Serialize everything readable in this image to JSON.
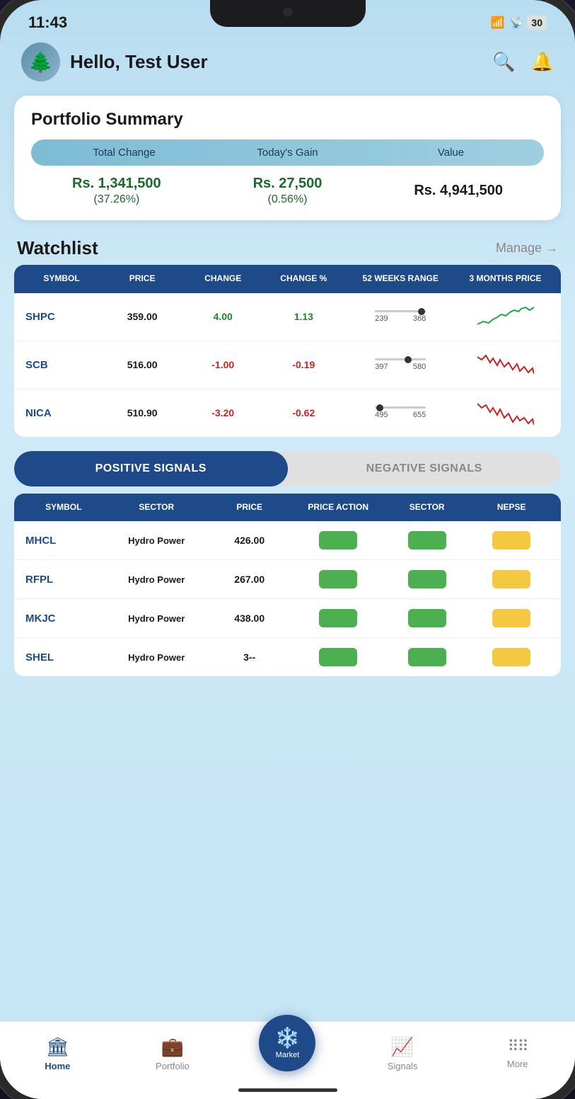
{
  "status": {
    "time": "11:43",
    "battery": "30"
  },
  "header": {
    "greeting": "Hello, Test User"
  },
  "portfolio": {
    "title": "Portfolio Summary",
    "col_total_change": "Total Change",
    "col_todays_gain": "Today's Gain",
    "col_value": "Value",
    "total_change_amount": "Rs. 1,341,500",
    "total_change_percent": "(37.26%)",
    "todays_gain_amount": "Rs. 27,500",
    "todays_gain_percent": "(0.56%)",
    "value_amount": "Rs. 4,941,500"
  },
  "watchlist": {
    "title": "Watchlist",
    "manage_label": "Manage →",
    "headers": [
      "SYMBOL",
      "PRICE",
      "CHANGE",
      "CHANGE %",
      "52 WEEKS RANGE",
      "3 MONTHS PRICE"
    ],
    "rows": [
      {
        "symbol": "SHPC",
        "price": "359.00",
        "change": "4.00",
        "change_pct": "1.13",
        "range_min": "239",
        "range_max": "368",
        "dot_pct": 92,
        "trend": "up"
      },
      {
        "symbol": "SCB",
        "price": "516.00",
        "change": "-1.00",
        "change_pct": "-0.19",
        "range_min": "397",
        "range_max": "580",
        "dot_pct": 65,
        "trend": "down"
      },
      {
        "symbol": "NICA",
        "price": "510.90",
        "change": "-3.20",
        "change_pct": "-0.62",
        "range_min": "495",
        "range_max": "655",
        "dot_pct": 10,
        "trend": "down"
      }
    ]
  },
  "signals": {
    "positive_label": "POSITIVE SIGNALS",
    "negative_label": "NEGATIVE SIGNALS",
    "active_tab": "positive",
    "headers": [
      "SYMBOL",
      "SECTOR",
      "PRICE",
      "PRICE ACTION",
      "SECTOR",
      "NEPSE"
    ],
    "rows": [
      {
        "symbol": "MHCL",
        "sector": "Hydro Power",
        "price": "426.00",
        "price_action": "green",
        "sector_badge": "green",
        "nepse_badge": "yellow"
      },
      {
        "symbol": "RFPL",
        "sector": "Hydro Power",
        "price": "267.00",
        "price_action": "green",
        "sector_badge": "green",
        "nepse_badge": "yellow"
      },
      {
        "symbol": "MKJC",
        "sector": "Hydro Power",
        "price": "438.00",
        "price_action": "green",
        "sector_badge": "green",
        "nepse_badge": "yellow"
      },
      {
        "symbol": "SHEL",
        "sector": "Hydro Power",
        "price": "3??",
        "price_action": "green",
        "sector_badge": "green",
        "nepse_badge": "yellow"
      }
    ]
  },
  "bottom_nav": {
    "items": [
      {
        "label": "Home",
        "icon": "🏛",
        "active": true
      },
      {
        "label": "Portfolio",
        "icon": "💼",
        "active": false
      },
      {
        "label": "Market",
        "icon": "❄️",
        "active": false,
        "fab": true
      },
      {
        "label": "Signals",
        "icon": "📈",
        "active": false
      },
      {
        "label": "More",
        "icon": "⋮⋮",
        "active": false
      }
    ]
  }
}
